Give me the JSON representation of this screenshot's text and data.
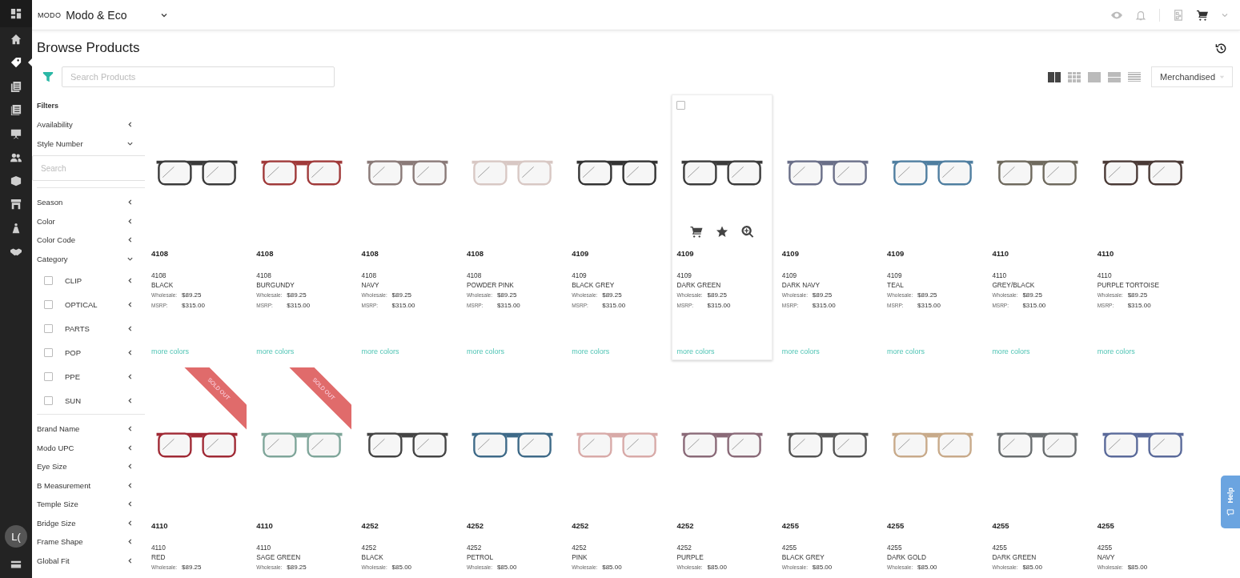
{
  "nav": [
    {
      "selected": false
    },
    {
      "selected": true
    },
    {
      "selected": false
    },
    {
      "selected": false
    },
    {
      "selected": false
    },
    {
      "selected": false
    },
    {
      "selected": false
    },
    {
      "selected": false
    },
    {
      "selected": false
    },
    {
      "selected": false
    }
  ],
  "avatar": "L(",
  "brand": {
    "logo": "MODO",
    "name": "Modo & Eco"
  },
  "page_title": "Browse Products",
  "search": {
    "placeholder": "Search Products"
  },
  "views": [
    {
      "selected": true
    },
    {
      "selected": false
    },
    {
      "selected": false
    },
    {
      "selected": false
    },
    {
      "selected": false
    }
  ],
  "sort": {
    "value": "Merchandised"
  },
  "filters": {
    "title": "Filters",
    "groups": [
      {
        "label": "Availability",
        "expanded": false
      },
      {
        "label": "Style Number",
        "expanded": true,
        "search_placeholder": "Search"
      },
      {
        "label": "Season",
        "expanded": false
      },
      {
        "label": "Color",
        "expanded": false
      },
      {
        "label": "Color Code",
        "expanded": false
      },
      {
        "label": "Category",
        "expanded": true,
        "options": [
          {
            "label": "CLIP",
            "checked": false
          },
          {
            "label": "OPTICAL",
            "checked": false
          },
          {
            "label": "PARTS",
            "checked": false
          },
          {
            "label": "POP",
            "checked": false
          },
          {
            "label": "PPE",
            "checked": false
          },
          {
            "label": "SUN",
            "checked": false
          }
        ]
      },
      {
        "label": "Brand Name",
        "expanded": false
      },
      {
        "label": "Modo UPC",
        "expanded": false
      },
      {
        "label": "Eye Size",
        "expanded": false
      },
      {
        "label": "B Measurement",
        "expanded": false
      },
      {
        "label": "Temple Size",
        "expanded": false
      },
      {
        "label": "Bridge Size",
        "expanded": false
      },
      {
        "label": "Frame Shape",
        "expanded": false
      },
      {
        "label": "Global Fit",
        "expanded": false
      }
    ]
  },
  "products": [
    {
      "style": "4108",
      "code": "4108",
      "color_name": "BLACK",
      "wholesale_label": "Wholesale:",
      "wholesale": "$89.25",
      "msrp_label": "MSRP:",
      "msrp": "$315.00",
      "more_colors": "more colors",
      "color": "#3a3a3a",
      "hovered": false
    },
    {
      "style": "4108",
      "code": "4108",
      "color_name": "BURGUNDY",
      "wholesale_label": "Wholesale:",
      "wholesale": "$89.25",
      "msrp_label": "MSRP:",
      "msrp": "$315.00",
      "more_colors": "more colors",
      "color": "#a03a3a",
      "hovered": false
    },
    {
      "style": "4108",
      "code": "4108",
      "color_name": "NAVY",
      "wholesale_label": "Wholesale:",
      "wholesale": "$89.25",
      "msrp_label": "MSRP:",
      "msrp": "$315.00",
      "more_colors": "more colors",
      "color": "#8a7a78",
      "hovered": false
    },
    {
      "style": "4108",
      "code": "4108",
      "color_name": "POWDER PINK",
      "wholesale_label": "Wholesale:",
      "wholesale": "$89.25",
      "msrp_label": "MSRP:",
      "msrp": "$315.00",
      "more_colors": "more colors",
      "color": "#d8c8c4",
      "hovered": false
    },
    {
      "style": "4109",
      "code": "4109",
      "color_name": "BLACK GREY",
      "wholesale_label": "Wholesale:",
      "wholesale": "$89.25",
      "msrp_label": "MSRP:",
      "msrp": "$315.00",
      "more_colors": "more colors",
      "color": "#333333",
      "hovered": false
    },
    {
      "style": "4109",
      "code": "4109",
      "color_name": "DARK GREEN",
      "wholesale_label": "Wholesale:",
      "wholesale": "$89.25",
      "msrp_label": "MSRP:",
      "msrp": "$315.00",
      "more_colors": "more colors",
      "color": "#3b3b3b",
      "hovered": true,
      "checked": false
    },
    {
      "style": "4109",
      "code": "4109",
      "color_name": "DARK NAVY",
      "wholesale_label": "Wholesale:",
      "wholesale": "$89.25",
      "msrp_label": "MSRP:",
      "msrp": "$315.00",
      "more_colors": "more colors",
      "color": "#6a6f88",
      "hovered": false
    },
    {
      "style": "4109",
      "code": "4109",
      "color_name": "TEAL",
      "wholesale_label": "Wholesale:",
      "wholesale": "$89.25",
      "msrp_label": "MSRP:",
      "msrp": "$315.00",
      "more_colors": "more colors",
      "color": "#4f7ea0",
      "hovered": false
    },
    {
      "style": "4110",
      "code": "4110",
      "color_name": "GREY/BLACK",
      "wholesale_label": "Wholesale:",
      "wholesale": "$89.25",
      "msrp_label": "MSRP:",
      "msrp": "$315.00",
      "more_colors": "more colors",
      "color": "#6f6a5e",
      "hovered": false
    },
    {
      "style": "4110",
      "code": "4110",
      "color_name": "PURPLE TORTOISE",
      "wholesale_label": "Wholesale:",
      "wholesale": "$89.25",
      "msrp_label": "MSRP:",
      "msrp": "$315.00",
      "more_colors": "more colors",
      "color": "#4a3a36",
      "hovered": false
    },
    {
      "style": "4110",
      "code": "4110",
      "color_name": "RED",
      "wholesale_label": "Wholesale:",
      "wholesale": "$89.25",
      "color": "#a02a35",
      "hovered": false,
      "badge": "SOLD OUT"
    },
    {
      "style": "4110",
      "code": "4110",
      "color_name": "SAGE GREEN",
      "wholesale_label": "Wholesale:",
      "wholesale": "$89.25",
      "color": "#7fa69a",
      "hovered": false,
      "badge": "SOLD OUT"
    },
    {
      "style": "4252",
      "code": "4252",
      "color_name": "BLACK",
      "wholesale_label": "Wholesale:",
      "wholesale": "$85.00",
      "color": "#444444",
      "hovered": false
    },
    {
      "style": "4252",
      "code": "4252",
      "color_name": "PETROL",
      "wholesale_label": "Wholesale:",
      "wholesale": "$85.00",
      "color": "#3e6a88",
      "hovered": false
    },
    {
      "style": "4252",
      "code": "4252",
      "color_name": "PINK",
      "wholesale_label": "Wholesale:",
      "wholesale": "$85.00",
      "color": "#d8aaa8",
      "hovered": false
    },
    {
      "style": "4252",
      "code": "4252",
      "color_name": "PURPLE",
      "wholesale_label": "Wholesale:",
      "wholesale": "$85.00",
      "color": "#8a6a78",
      "hovered": false
    },
    {
      "style": "4255",
      "code": "4255",
      "color_name": "BLACK GREY",
      "wholesale_label": "Wholesale:",
      "wholesale": "$85.00",
      "color": "#555555",
      "hovered": false
    },
    {
      "style": "4255",
      "code": "4255",
      "color_name": "DARK GOLD",
      "wholesale_label": "Wholesale:",
      "wholesale": "$85.00",
      "color": "#c8aa8a",
      "hovered": false
    },
    {
      "style": "4255",
      "code": "4255",
      "color_name": "DARK GREEN",
      "wholesale_label": "Wholesale:",
      "wholesale": "$85.00",
      "color": "#6a6e70",
      "hovered": false
    },
    {
      "style": "4255",
      "code": "4255",
      "color_name": "NAVY",
      "wholesale_label": "Wholesale:",
      "wholesale": "$85.00",
      "color": "#5a6a9a",
      "hovered": false
    }
  ],
  "help": {
    "label": "Help"
  }
}
